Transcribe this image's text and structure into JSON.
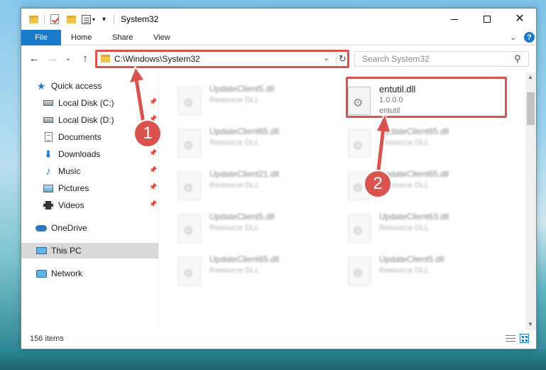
{
  "window": {
    "title": "System32",
    "minimize": "",
    "maximize": "",
    "close": "✕"
  },
  "ribbon": {
    "tabs": [
      {
        "label": "File"
      },
      {
        "label": "Home"
      },
      {
        "label": "Share"
      },
      {
        "label": "View"
      }
    ],
    "help": "?",
    "expand": "⌄"
  },
  "nav": {
    "back": "←",
    "forward": "→",
    "recent": "⌄",
    "up": "↑",
    "address": "C:\\Windows\\System32",
    "address_dropdown": "⌄",
    "refresh": "↻",
    "search_placeholder": "Search System32",
    "search_glyph": "⚲"
  },
  "sidebar": {
    "items": [
      {
        "label": "Quick access",
        "icon": "star-icon",
        "pinned": false
      },
      {
        "label": "Local Disk (C:)",
        "icon": "drive-icon",
        "pinned": true
      },
      {
        "label": "Local Disk (D:)",
        "icon": "drive-icon",
        "pinned": true
      },
      {
        "label": "Documents",
        "icon": "documents-icon",
        "pinned": true
      },
      {
        "label": "Downloads",
        "icon": "downloads-icon",
        "pinned": true
      },
      {
        "label": "Music",
        "icon": "music-icon",
        "pinned": true
      },
      {
        "label": "Pictures",
        "icon": "pictures-icon",
        "pinned": true
      },
      {
        "label": "Videos",
        "icon": "videos-icon",
        "pinned": true
      },
      {
        "label": "OneDrive",
        "icon": "onedrive-icon",
        "pinned": false
      },
      {
        "label": "This PC",
        "icon": "this-pc-icon",
        "pinned": false,
        "selected": true
      },
      {
        "label": "Network",
        "icon": "network-icon",
        "pinned": false
      }
    ],
    "pin_glyph": "📌"
  },
  "files": {
    "highlighted": {
      "name": "entutil.dll",
      "version": "1.0.0.0",
      "description": "entutil"
    },
    "left_column": [
      {
        "name": "UpdateClient5.dll",
        "type": "Resource DLL"
      },
      {
        "name": "UpdateClient65.dll",
        "type": "Resource DLL"
      },
      {
        "name": "UpdateClient21.dll",
        "type": "Resource DLL"
      },
      {
        "name": "UpdateClient5.dll",
        "type": "Resource DLL"
      },
      {
        "name": "UpdateClient65.dll",
        "type": "Resource DLL"
      }
    ],
    "right_column": [
      {
        "name": "UpdateClient65.dll",
        "type": "Resource DLL"
      },
      {
        "name": "UpdateClient65.dll",
        "type": "Resource DLL"
      },
      {
        "name": "UpdateClient63.dll",
        "type": "Resource DLL"
      },
      {
        "name": "UpdateClient5.dll",
        "type": "Resource DLL"
      }
    ]
  },
  "status": {
    "item_count": "156 items"
  },
  "scrollbar": {
    "up": "▲",
    "down": "▼"
  },
  "annotations": {
    "step1": "1",
    "step2": "2",
    "color": "#d9534f"
  }
}
